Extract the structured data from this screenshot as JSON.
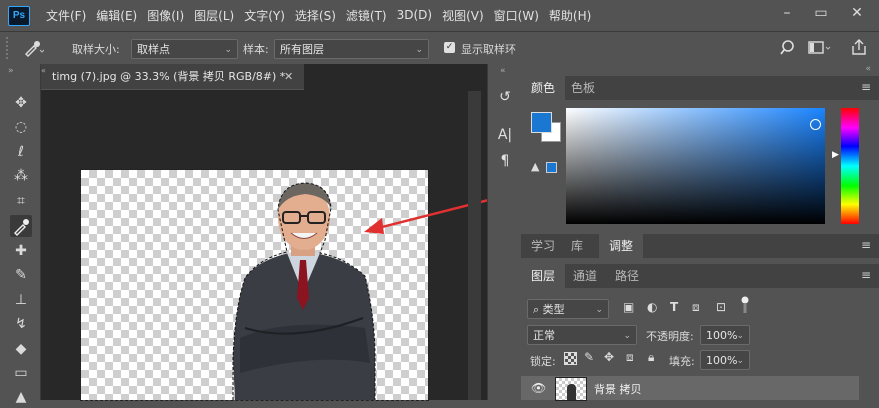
{
  "app": {
    "logo": "Ps",
    "accent": "#31a8ff"
  },
  "menubar": {
    "items": [
      "文件(F)",
      "编辑(E)",
      "图像(I)",
      "图层(L)",
      "文字(Y)",
      "选择(S)",
      "滤镜(T)",
      "3D(D)",
      "视图(V)",
      "窗口(W)",
      "帮助(H)"
    ]
  },
  "options": {
    "sample_size_label": "取样大小:",
    "sample_size_value": "取样点",
    "sample_label": "样本:",
    "sample_value": "所有图层",
    "show_ring_label": "显示取样环",
    "show_ring_checked": true
  },
  "document": {
    "tab_title": "timg (7).jpg @ 33.3% (背景 拷贝  RGB/8#) *"
  },
  "color_panel": {
    "tabs": [
      "颜色",
      "色板"
    ],
    "foreground": "#1a78d2",
    "background": "#ffffff"
  },
  "adjust_panel": {
    "tabs": [
      "学习",
      "库",
      "调整"
    ]
  },
  "layers_panel": {
    "tabs": [
      "图层",
      "通道",
      "路径"
    ],
    "filter_value": "类型",
    "blend_mode": "正常",
    "opacity_label": "不透明度:",
    "opacity_value": "100%",
    "lock_label": "锁定:",
    "fill_label": "填充:",
    "fill_value": "100%",
    "layers": [
      {
        "name": "背景 拷贝",
        "visible": true
      }
    ]
  }
}
